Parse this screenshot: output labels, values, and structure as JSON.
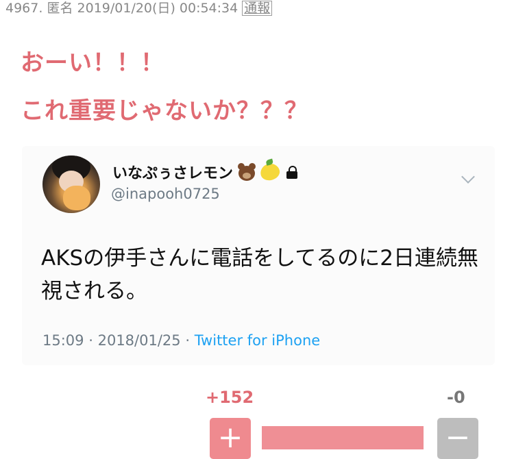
{
  "post": {
    "number": "4967.",
    "author": "匿名",
    "datetime": "2019/01/20(日) 00:54:34",
    "report_label": "通報"
  },
  "comment": {
    "line1": "おーい！！！",
    "line2": "これ重要じゃないか？？？"
  },
  "tweet": {
    "display_name": "いなぷぅさレモン",
    "name_emoji": [
      "bear-emoji",
      "lemon-emoji",
      "lock-icon"
    ],
    "handle": "@inapooh0725",
    "text": "AKSの伊手さんに電話をしてるのに2日連続無視される。",
    "time": "15:09",
    "separator1": "·",
    "date": "2018/01/25",
    "separator2": "·",
    "source": "Twitter for iPhone"
  },
  "votes": {
    "plus_count": "+152",
    "minus_count": "-0",
    "plus_label": "+",
    "minus_label": "−",
    "plus_ratio": 1.0
  },
  "colors": {
    "accent_pink": "#e06a72",
    "twitter_blue": "#1da1f2",
    "minus_gray": "#bdbdbd"
  }
}
